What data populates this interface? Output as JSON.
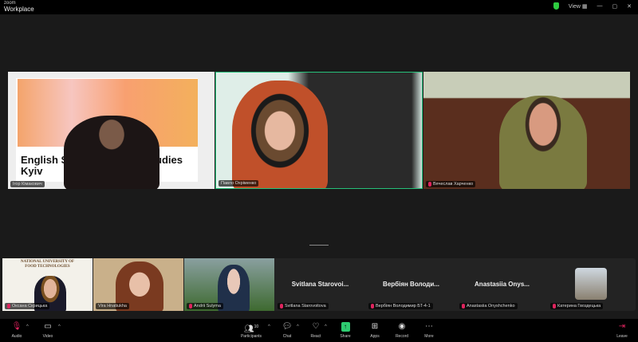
{
  "app": {
    "brand_small": "zoom",
    "brand": "Workplace",
    "view_label": "View"
  },
  "main_tiles": [
    {
      "name": "Ігор Кімакович",
      "slide_title": "English Speaking ... EuroStudies Kyiv"
    },
    {
      "name": "Павло Охріменко",
      "active": true
    },
    {
      "name": "Вячеслав Харченко"
    }
  ],
  "gallery": [
    {
      "name": "Оксана Скрицька",
      "banner": "NATIONAL UNIVERSITY OF FOOD TECHNOLOGIES"
    },
    {
      "name": "Vira Hnatiukha"
    },
    {
      "name": "Andrii Sulyma"
    },
    {
      "name": "Svitlana Starovoitova",
      "display": "Svitlana Starovoi..."
    },
    {
      "name": "Вербіян Володимир БТ-4-1",
      "display": "Вербіян Володи..."
    },
    {
      "name": "Anastasiia Onyshchenko",
      "display": "Anastasiia Onys..."
    },
    {
      "name": "Катерина Гвоздецька"
    }
  ],
  "toolbar": {
    "audio": "Audio",
    "video": "Video",
    "participants": "Participants",
    "participants_count": "10",
    "chat": "Chat",
    "react": "React",
    "share": "Share",
    "apps": "Apps",
    "record": "Record",
    "more": "More",
    "leave": "Leave"
  },
  "colors": {
    "active_border": "#27c07a",
    "share": "#2ecc71",
    "mute": "#e0245e"
  }
}
